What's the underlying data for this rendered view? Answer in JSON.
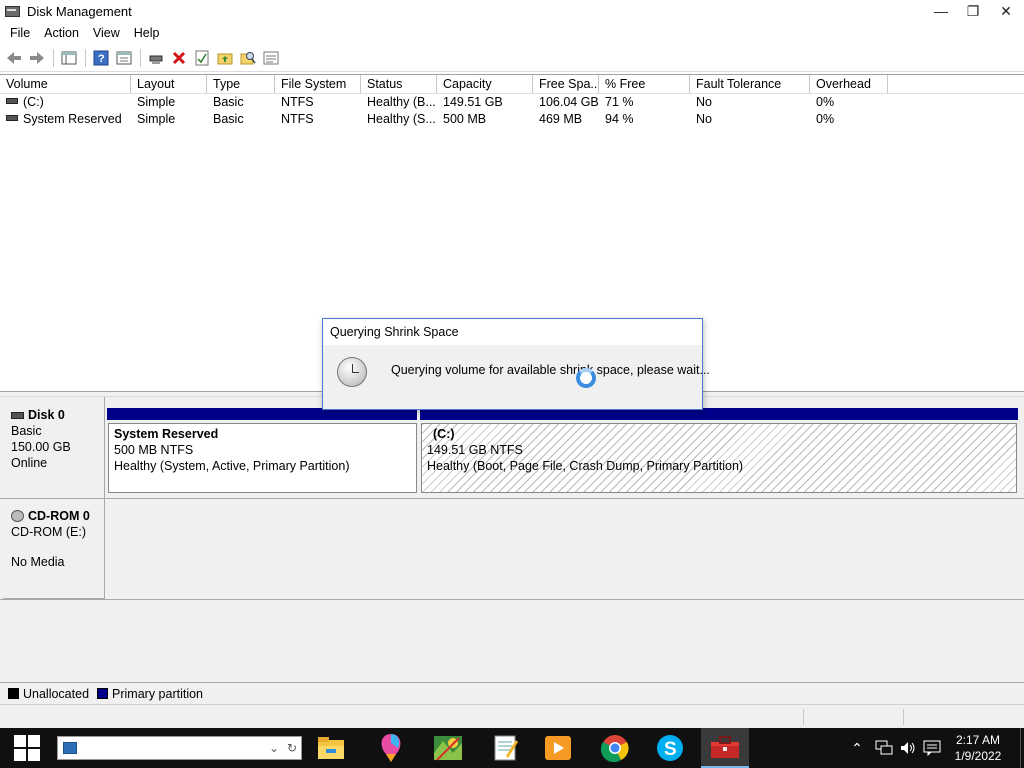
{
  "window": {
    "title": "Disk Management",
    "controls": {
      "minimize": "—",
      "restore": "❐",
      "close": "✕"
    }
  },
  "menu": [
    "File",
    "Action",
    "View",
    "Help"
  ],
  "toolbar": {
    "icons": [
      "back-icon",
      "forward-icon",
      "console-tree-icon",
      "help-icon",
      "properties-icon",
      "connect-icon",
      "delete-icon",
      "check-icon",
      "folder-up-icon",
      "search-folder-icon",
      "list-view-icon"
    ]
  },
  "volume_list": {
    "columns": [
      "Volume",
      "Layout",
      "Type",
      "File System",
      "Status",
      "Capacity",
      "Free Spa...",
      "% Free",
      "Fault Tolerance",
      "Overhead"
    ],
    "rows": [
      {
        "volume": "(C:)",
        "layout": "Simple",
        "type": "Basic",
        "fs": "NTFS",
        "status": "Healthy (B...",
        "capacity": "149.51 GB",
        "free": "106.04 GB",
        "pct": "71 %",
        "fault": "No",
        "overhead": "0%"
      },
      {
        "volume": "System Reserved",
        "layout": "Simple",
        "type": "Basic",
        "fs": "NTFS",
        "status": "Healthy (S...",
        "capacity": "500 MB",
        "free": "469 MB",
        "pct": "94 %",
        "fault": "No",
        "overhead": "0%"
      }
    ]
  },
  "disks": [
    {
      "name": "Disk 0",
      "type": "Basic",
      "size": "150.00 GB",
      "state": "Online",
      "partitions": [
        {
          "name": "System Reserved",
          "detail": "500 MB NTFS",
          "status": "Healthy (System, Active, Primary Partition)"
        },
        {
          "name": "(C:)",
          "detail": "149.51 GB NTFS",
          "status": "Healthy (Boot, Page File, Crash Dump, Primary Partition)"
        }
      ]
    },
    {
      "name": "CD-ROM 0",
      "drive": "CD-ROM (E:)",
      "media": "No Media"
    }
  ],
  "legend": [
    {
      "label": "Unallocated",
      "color": "#000000"
    },
    {
      "label": "Primary partition",
      "color": "#00008b"
    }
  ],
  "dialog": {
    "title": "Querying Shrink Space",
    "message": "Querying volume for available shrink space, please wait..."
  },
  "taskbar": {
    "search_placeholder": "",
    "apps": [
      "file-explorer-icon",
      "paint-3d-icon",
      "maps-icon",
      "notepad-icon",
      "media-player-icon",
      "chrome-icon",
      "skype-icon",
      "toolbox-icon"
    ],
    "tray": [
      "chevron-up-icon",
      "network-icon",
      "volume-icon",
      "action-center-icon"
    ],
    "time": "2:17 AM",
    "date": "1/9/2022"
  }
}
